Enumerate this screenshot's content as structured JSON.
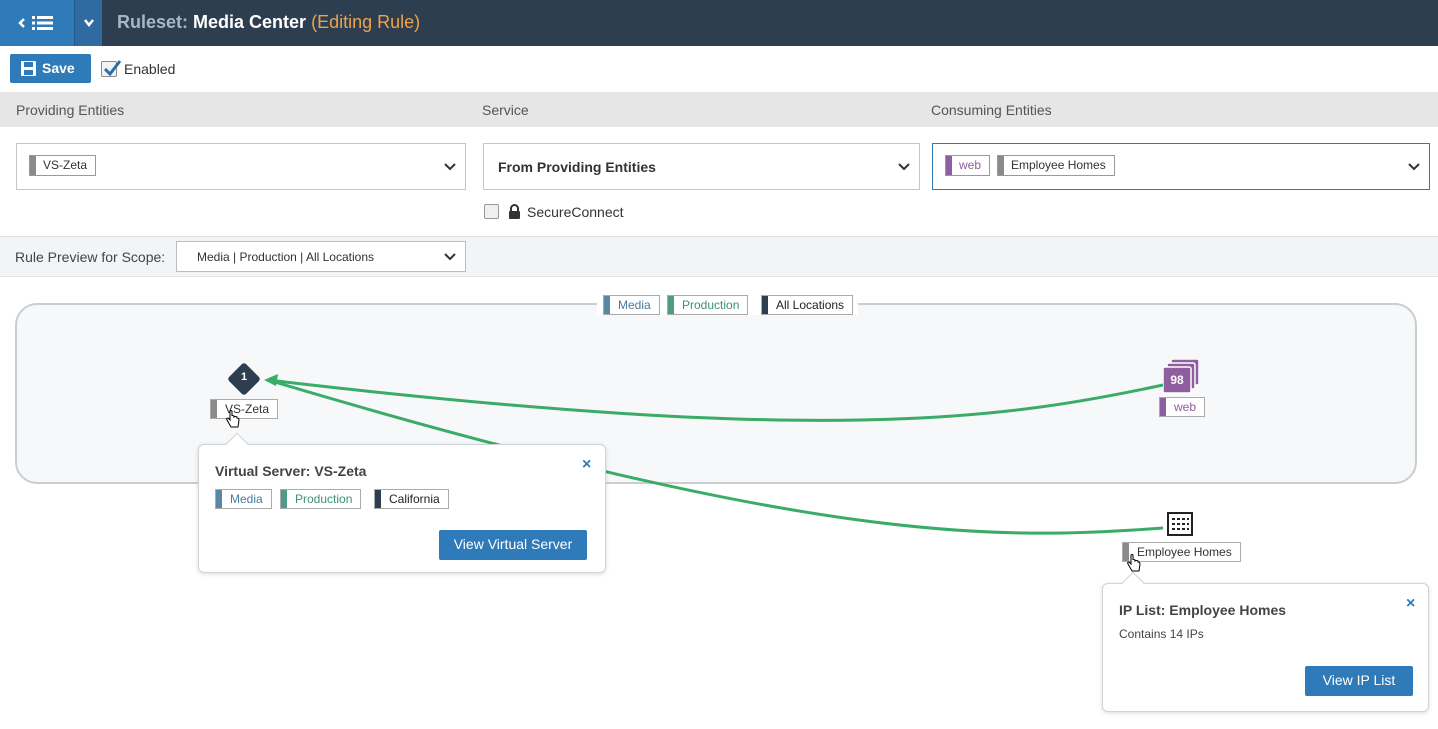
{
  "header": {
    "title_prefix": "Ruleset:",
    "title_name": "Media Center",
    "title_status": "(Editing Rule)"
  },
  "toolbar": {
    "save_label": "Save",
    "enabled_label": "Enabled",
    "enabled_checked": true
  },
  "columns": {
    "providing": "Providing Entities",
    "service": "Service",
    "consuming": "Consuming Entities"
  },
  "providing_field": {
    "chips": [
      {
        "label": "VS-Zeta",
        "color": "#8a8a8a"
      }
    ]
  },
  "service_field": {
    "value": "From Providing Entities"
  },
  "consuming_field": {
    "chips": [
      {
        "label": "web",
        "color": "#8e5e9e"
      },
      {
        "label": "Employee Homes",
        "color": "#8a8a8a"
      }
    ]
  },
  "secure_connect": {
    "label": "SecureConnect",
    "checked": false
  },
  "scope": {
    "label": "Rule Preview for Scope:",
    "value": "Media | Production | All Locations"
  },
  "diagram": {
    "scope_labels": [
      {
        "label": "Media",
        "color": "#5b87a6"
      },
      {
        "label": "Production",
        "color": "#4d9a86"
      },
      {
        "label": "All Locations",
        "color": "#2d3e50"
      }
    ],
    "provider_node": {
      "count": "1",
      "label": "VS-Zeta"
    },
    "group_node": {
      "count": "98",
      "label": "web"
    },
    "iplist_node": {
      "label": "Employee Homes"
    },
    "line_color": "#3bab68"
  },
  "popup_vs": {
    "title": "Virtual Server: VS-Zeta",
    "labels": [
      {
        "label": "Media",
        "color": "#5b87a6"
      },
      {
        "label": "Production",
        "color": "#4d9a86"
      },
      {
        "label": "California",
        "color": "#2d3e50"
      }
    ],
    "button": "View Virtual Server",
    "close": "×"
  },
  "popup_ip": {
    "title": "IP List: Employee Homes",
    "body": "Contains 14 IPs",
    "button": "View IP List",
    "close": "×"
  }
}
